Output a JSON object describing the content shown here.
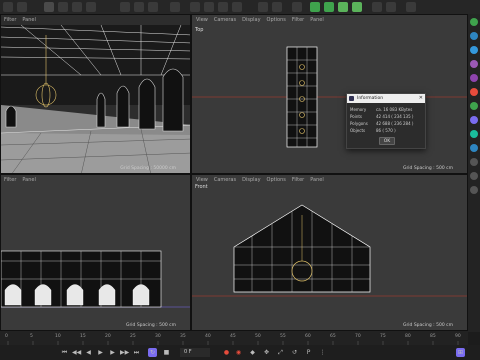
{
  "viewports": {
    "perspective": {
      "grid_spacing": "Grid Spacing : 50000 cm",
      "menu": [
        "Filter",
        "Panel"
      ]
    },
    "top": {
      "label": "Top",
      "grid_spacing": "Grid Spacing : 500 cm",
      "menu": [
        "View",
        "Cameras",
        "Display",
        "Options",
        "Filter",
        "Panel"
      ]
    },
    "right": {
      "grid_spacing": "Grid Spacing : 500 cm",
      "menu": [
        "Filter",
        "Panel"
      ]
    },
    "front": {
      "label": "Front",
      "grid_spacing": "Grid Spacing : 500 cm",
      "menu": [
        "View",
        "Cameras",
        "Display",
        "Options",
        "Filter",
        "Panel"
      ]
    }
  },
  "info_dialog": {
    "title": "Information",
    "rows": [
      {
        "key": "Memory",
        "value": "ca. 16 083 KBytes"
      },
      {
        "key": "Points",
        "value": "42 414 ( 234 135 )"
      },
      {
        "key": "Polygons",
        "value": "42 688 ( 236 284 )"
      },
      {
        "key": "Objects",
        "value": "86 ( 570 )"
      }
    ],
    "ok_label": "OK"
  },
  "timeline": {
    "ticks": [
      "0",
      "5",
      "10",
      "15",
      "20",
      "25",
      "30",
      "35",
      "40",
      "45",
      "50",
      "55",
      "60",
      "65",
      "70",
      "75",
      "80",
      "85",
      "90"
    ]
  },
  "transport": {
    "frame_field": "0 F"
  },
  "colors": {
    "accent": "#7a6cf0",
    "axis_red": "#c0392b",
    "wire_white": "#ffffff",
    "viewport_bg": "#3a3a3a"
  }
}
